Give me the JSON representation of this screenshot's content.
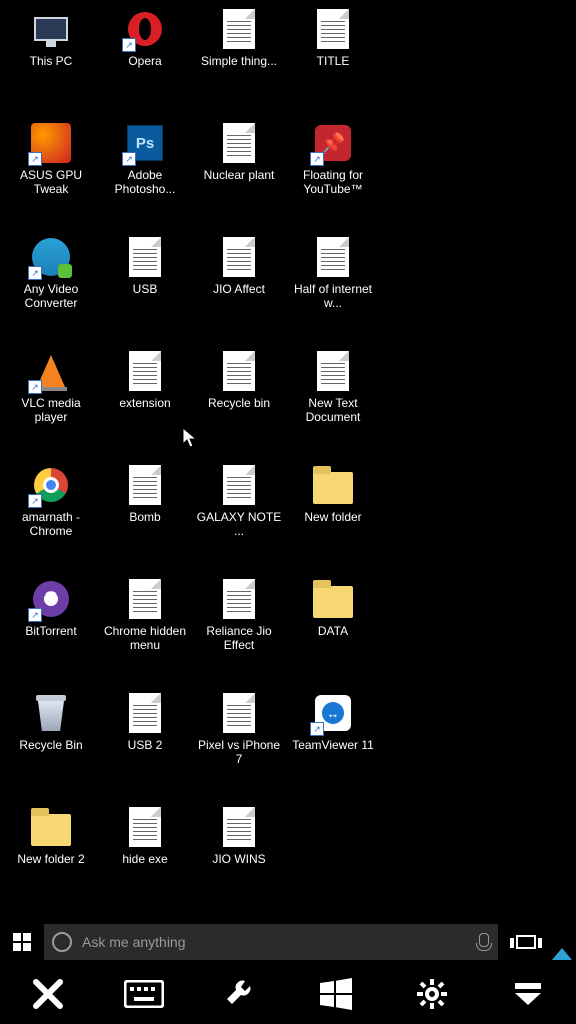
{
  "desktop": {
    "icons": [
      {
        "label": "This PC",
        "type": "thispc",
        "shortcut": false
      },
      {
        "label": "Opera",
        "type": "opera",
        "shortcut": true
      },
      {
        "label": "Simple thing...",
        "type": "doc",
        "shortcut": false
      },
      {
        "label": "TITLE",
        "type": "doc",
        "shortcut": false
      },
      {
        "label": "ASUS GPU Tweak",
        "type": "asus",
        "shortcut": true
      },
      {
        "label": "Adobe Photosho...",
        "type": "ps",
        "shortcut": true
      },
      {
        "label": "Nuclear plant",
        "type": "doc",
        "shortcut": false
      },
      {
        "label": "Floating for YouTube™",
        "type": "pin",
        "shortcut": true
      },
      {
        "label": "Any Video Converter",
        "type": "avc",
        "shortcut": true
      },
      {
        "label": "USB",
        "type": "doc",
        "shortcut": false
      },
      {
        "label": "JIO Affect",
        "type": "doc",
        "shortcut": false
      },
      {
        "label": "Half of internet w...",
        "type": "doc",
        "shortcut": false
      },
      {
        "label": "VLC media player",
        "type": "vlc",
        "shortcut": true
      },
      {
        "label": "extension",
        "type": "doc",
        "shortcut": false
      },
      {
        "label": "Recycle bin",
        "type": "doc",
        "shortcut": false
      },
      {
        "label": "New Text Document",
        "type": "doc",
        "shortcut": false
      },
      {
        "label": "amarnath - Chrome",
        "type": "chrome",
        "shortcut": true
      },
      {
        "label": "Bomb",
        "type": "doc",
        "shortcut": false
      },
      {
        "label": "GALAXY NOTE ...",
        "type": "doc",
        "shortcut": false
      },
      {
        "label": "New folder",
        "type": "folder",
        "shortcut": false
      },
      {
        "label": "BitTorrent",
        "type": "bittorrent",
        "shortcut": true
      },
      {
        "label": "Chrome hidden menu",
        "type": "doc",
        "shortcut": false
      },
      {
        "label": "Reliance Jio Effect",
        "type": "doc",
        "shortcut": false
      },
      {
        "label": "DATA",
        "type": "folder",
        "shortcut": false
      },
      {
        "label": "Recycle Bin",
        "type": "recyclebin",
        "shortcut": false
      },
      {
        "label": "USB 2",
        "type": "doc",
        "shortcut": false
      },
      {
        "label": "Pixel vs iPhone 7",
        "type": "doc",
        "shortcut": false
      },
      {
        "label": "TeamViewer 11",
        "type": "teamviewer",
        "shortcut": true
      },
      {
        "label": "New folder 2",
        "type": "folder",
        "shortcut": false
      },
      {
        "label": "hide exe",
        "type": "doc",
        "shortcut": false
      },
      {
        "label": "JIO WINS",
        "type": "doc",
        "shortcut": false
      }
    ]
  },
  "taskbar": {
    "search_placeholder": "Ask me anything"
  }
}
